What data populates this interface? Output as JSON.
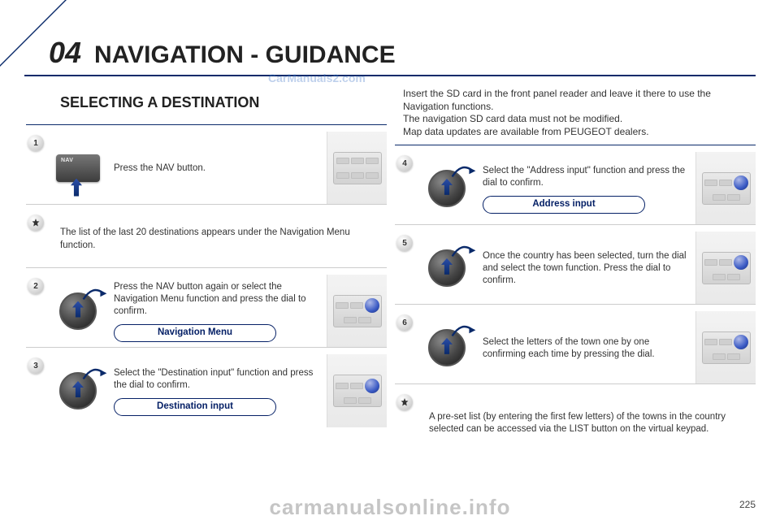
{
  "chapter": {
    "num": "04",
    "title": "NAVIGATION - GUIDANCE"
  },
  "subtitle": "SELECTING A DESTINATION",
  "intro": "Insert the SD card in the front panel reader and leave it there to use the Navigation functions.\nThe navigation SD card data must not be modified.\nMap data updates are available from PEUGEOT dealers.",
  "left": {
    "step1": {
      "num": "1",
      "text": "Press the NAV button."
    },
    "hint1": {
      "text": "The list of the last 20 destinations appears under the Navigation Menu function."
    },
    "step2": {
      "num": "2",
      "text": "Press the NAV button again or select the Navigation Menu function and press the dial to confirm.",
      "pill": "Navigation Menu"
    },
    "step3": {
      "num": "3",
      "text": "Select the \"Destination input\" function and press the dial to confirm.",
      "pill": "Destination input"
    }
  },
  "right": {
    "step4": {
      "num": "4",
      "text": "Select the \"Address input\" function and press the dial to confirm.",
      "pill": "Address input"
    },
    "step5": {
      "num": "5",
      "text": "Once the country has been selected, turn the dial and select the town function. Press the dial to confirm."
    },
    "step6": {
      "num": "6",
      "text": "Select the letters of the town one by one confirming each time by pressing the dial."
    },
    "hint2": {
      "text": "A pre-set list (by entering the first few letters) of the towns in the country selected can be accessed via the LIST button on the virtual keypad."
    }
  },
  "watermarks": {
    "top": "CarManuals2.com",
    "bottom": "carmanualsonline.info"
  },
  "page_footer": "225",
  "nav_label": "NAV"
}
